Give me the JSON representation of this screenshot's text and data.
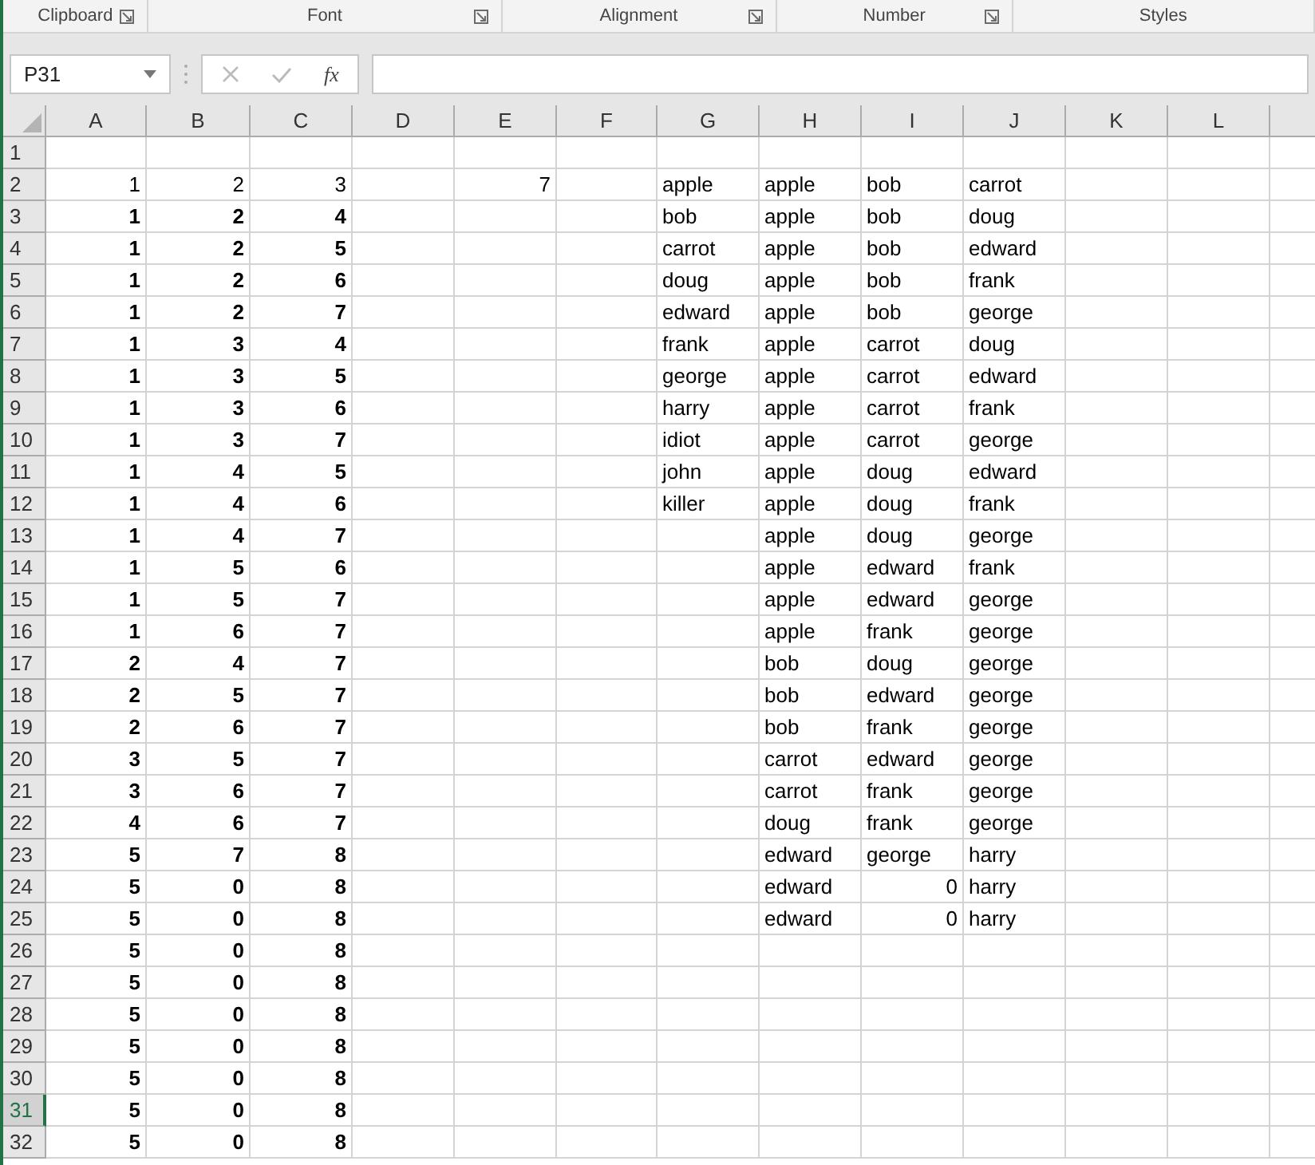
{
  "ribbon_groups": [
    {
      "label": "Clipboard",
      "launcher": true
    },
    {
      "label": "Font",
      "launcher": true
    },
    {
      "label": "Alignment",
      "launcher": true
    },
    {
      "label": "Number",
      "launcher": true
    },
    {
      "label": "Styles",
      "launcher": false
    }
  ],
  "name_box": {
    "value": "P31"
  },
  "formula_bar": {
    "fx": "fx"
  },
  "columns": [
    "A",
    "B",
    "C",
    "D",
    "E",
    "F",
    "G",
    "H",
    "I",
    "J",
    "K",
    "L"
  ],
  "rows": [
    {
      "header": "1",
      "selected": false,
      "cells": []
    },
    {
      "header": "2",
      "selected": false,
      "cells": [
        {
          "text": "1",
          "kind": "number",
          "bold": false
        },
        {
          "text": "2",
          "kind": "number",
          "bold": false
        },
        {
          "text": "3",
          "kind": "number",
          "bold": false
        },
        null,
        {
          "text": "7",
          "kind": "number",
          "bold": false
        },
        null,
        {
          "text": "apple",
          "kind": "text",
          "bold": false
        },
        {
          "text": "apple",
          "kind": "text",
          "bold": false
        },
        {
          "text": "bob",
          "kind": "text",
          "bold": false
        },
        {
          "text": "carrot",
          "kind": "text",
          "bold": false
        }
      ]
    },
    {
      "header": "3",
      "selected": false,
      "cells": [
        {
          "text": "1",
          "kind": "number",
          "bold": true
        },
        {
          "text": "2",
          "kind": "number",
          "bold": true
        },
        {
          "text": "4",
          "kind": "number",
          "bold": true
        },
        null,
        null,
        null,
        {
          "text": "bob",
          "kind": "text",
          "bold": false
        },
        {
          "text": "apple",
          "kind": "text",
          "bold": false
        },
        {
          "text": "bob",
          "kind": "text",
          "bold": false
        },
        {
          "text": "doug",
          "kind": "text",
          "bold": false
        }
      ]
    },
    {
      "header": "4",
      "selected": false,
      "cells": [
        {
          "text": "1",
          "kind": "number",
          "bold": true
        },
        {
          "text": "2",
          "kind": "number",
          "bold": true
        },
        {
          "text": "5",
          "kind": "number",
          "bold": true
        },
        null,
        null,
        null,
        {
          "text": "carrot",
          "kind": "text",
          "bold": false
        },
        {
          "text": "apple",
          "kind": "text",
          "bold": false
        },
        {
          "text": "bob",
          "kind": "text",
          "bold": false
        },
        {
          "text": "edward",
          "kind": "text",
          "bold": false
        }
      ]
    },
    {
      "header": "5",
      "selected": false,
      "cells": [
        {
          "text": "1",
          "kind": "number",
          "bold": true
        },
        {
          "text": "2",
          "kind": "number",
          "bold": true
        },
        {
          "text": "6",
          "kind": "number",
          "bold": true
        },
        null,
        null,
        null,
        {
          "text": "doug",
          "kind": "text",
          "bold": false
        },
        {
          "text": "apple",
          "kind": "text",
          "bold": false
        },
        {
          "text": "bob",
          "kind": "text",
          "bold": false
        },
        {
          "text": "frank",
          "kind": "text",
          "bold": false
        }
      ]
    },
    {
      "header": "6",
      "selected": false,
      "cells": [
        {
          "text": "1",
          "kind": "number",
          "bold": true
        },
        {
          "text": "2",
          "kind": "number",
          "bold": true
        },
        {
          "text": "7",
          "kind": "number",
          "bold": true
        },
        null,
        null,
        null,
        {
          "text": "edward",
          "kind": "text",
          "bold": false
        },
        {
          "text": "apple",
          "kind": "text",
          "bold": false
        },
        {
          "text": "bob",
          "kind": "text",
          "bold": false
        },
        {
          "text": "george",
          "kind": "text",
          "bold": false
        }
      ]
    },
    {
      "header": "7",
      "selected": false,
      "cells": [
        {
          "text": "1",
          "kind": "number",
          "bold": true
        },
        {
          "text": "3",
          "kind": "number",
          "bold": true
        },
        {
          "text": "4",
          "kind": "number",
          "bold": true
        },
        null,
        null,
        null,
        {
          "text": "frank",
          "kind": "text",
          "bold": false
        },
        {
          "text": "apple",
          "kind": "text",
          "bold": false
        },
        {
          "text": "carrot",
          "kind": "text",
          "bold": false
        },
        {
          "text": "doug",
          "kind": "text",
          "bold": false
        }
      ]
    },
    {
      "header": "8",
      "selected": false,
      "cells": [
        {
          "text": "1",
          "kind": "number",
          "bold": true
        },
        {
          "text": "3",
          "kind": "number",
          "bold": true
        },
        {
          "text": "5",
          "kind": "number",
          "bold": true
        },
        null,
        null,
        null,
        {
          "text": "george",
          "kind": "text",
          "bold": false
        },
        {
          "text": "apple",
          "kind": "text",
          "bold": false
        },
        {
          "text": "carrot",
          "kind": "text",
          "bold": false
        },
        {
          "text": "edward",
          "kind": "text",
          "bold": false
        }
      ]
    },
    {
      "header": "9",
      "selected": false,
      "cells": [
        {
          "text": "1",
          "kind": "number",
          "bold": true
        },
        {
          "text": "3",
          "kind": "number",
          "bold": true
        },
        {
          "text": "6",
          "kind": "number",
          "bold": true
        },
        null,
        null,
        null,
        {
          "text": "harry",
          "kind": "text",
          "bold": false
        },
        {
          "text": "apple",
          "kind": "text",
          "bold": false
        },
        {
          "text": "carrot",
          "kind": "text",
          "bold": false
        },
        {
          "text": "frank",
          "kind": "text",
          "bold": false
        }
      ]
    },
    {
      "header": "10",
      "selected": false,
      "cells": [
        {
          "text": "1",
          "kind": "number",
          "bold": true
        },
        {
          "text": "3",
          "kind": "number",
          "bold": true
        },
        {
          "text": "7",
          "kind": "number",
          "bold": true
        },
        null,
        null,
        null,
        {
          "text": "idiot",
          "kind": "text",
          "bold": false
        },
        {
          "text": "apple",
          "kind": "text",
          "bold": false
        },
        {
          "text": "carrot",
          "kind": "text",
          "bold": false
        },
        {
          "text": "george",
          "kind": "text",
          "bold": false
        }
      ]
    },
    {
      "header": "11",
      "selected": false,
      "cells": [
        {
          "text": "1",
          "kind": "number",
          "bold": true
        },
        {
          "text": "4",
          "kind": "number",
          "bold": true
        },
        {
          "text": "5",
          "kind": "number",
          "bold": true
        },
        null,
        null,
        null,
        {
          "text": "john",
          "kind": "text",
          "bold": false
        },
        {
          "text": "apple",
          "kind": "text",
          "bold": false
        },
        {
          "text": "doug",
          "kind": "text",
          "bold": false
        },
        {
          "text": "edward",
          "kind": "text",
          "bold": false
        }
      ]
    },
    {
      "header": "12",
      "selected": false,
      "cells": [
        {
          "text": "1",
          "kind": "number",
          "bold": true
        },
        {
          "text": "4",
          "kind": "number",
          "bold": true
        },
        {
          "text": "6",
          "kind": "number",
          "bold": true
        },
        null,
        null,
        null,
        {
          "text": "killer",
          "kind": "text",
          "bold": false
        },
        {
          "text": "apple",
          "kind": "text",
          "bold": false
        },
        {
          "text": "doug",
          "kind": "text",
          "bold": false
        },
        {
          "text": "frank",
          "kind": "text",
          "bold": false
        }
      ]
    },
    {
      "header": "13",
      "selected": false,
      "cells": [
        {
          "text": "1",
          "kind": "number",
          "bold": true
        },
        {
          "text": "4",
          "kind": "number",
          "bold": true
        },
        {
          "text": "7",
          "kind": "number",
          "bold": true
        },
        null,
        null,
        null,
        null,
        {
          "text": "apple",
          "kind": "text",
          "bold": false
        },
        {
          "text": "doug",
          "kind": "text",
          "bold": false
        },
        {
          "text": "george",
          "kind": "text",
          "bold": false
        }
      ]
    },
    {
      "header": "14",
      "selected": false,
      "cells": [
        {
          "text": "1",
          "kind": "number",
          "bold": true
        },
        {
          "text": "5",
          "kind": "number",
          "bold": true
        },
        {
          "text": "6",
          "kind": "number",
          "bold": true
        },
        null,
        null,
        null,
        null,
        {
          "text": "apple",
          "kind": "text",
          "bold": false
        },
        {
          "text": "edward",
          "kind": "text",
          "bold": false
        },
        {
          "text": "frank",
          "kind": "text",
          "bold": false
        }
      ]
    },
    {
      "header": "15",
      "selected": false,
      "cells": [
        {
          "text": "1",
          "kind": "number",
          "bold": true
        },
        {
          "text": "5",
          "kind": "number",
          "bold": true
        },
        {
          "text": "7",
          "kind": "number",
          "bold": true
        },
        null,
        null,
        null,
        null,
        {
          "text": "apple",
          "kind": "text",
          "bold": false
        },
        {
          "text": "edward",
          "kind": "text",
          "bold": false
        },
        {
          "text": "george",
          "kind": "text",
          "bold": false
        }
      ]
    },
    {
      "header": "16",
      "selected": false,
      "cells": [
        {
          "text": "1",
          "kind": "number",
          "bold": true
        },
        {
          "text": "6",
          "kind": "number",
          "bold": true
        },
        {
          "text": "7",
          "kind": "number",
          "bold": true
        },
        null,
        null,
        null,
        null,
        {
          "text": "apple",
          "kind": "text",
          "bold": false
        },
        {
          "text": "frank",
          "kind": "text",
          "bold": false
        },
        {
          "text": "george",
          "kind": "text",
          "bold": false
        }
      ]
    },
    {
      "header": "17",
      "selected": false,
      "cells": [
        {
          "text": "2",
          "kind": "number",
          "bold": true
        },
        {
          "text": "4",
          "kind": "number",
          "bold": true
        },
        {
          "text": "7",
          "kind": "number",
          "bold": true
        },
        null,
        null,
        null,
        null,
        {
          "text": "bob",
          "kind": "text",
          "bold": false
        },
        {
          "text": "doug",
          "kind": "text",
          "bold": false
        },
        {
          "text": "george",
          "kind": "text",
          "bold": false
        }
      ]
    },
    {
      "header": "18",
      "selected": false,
      "cells": [
        {
          "text": "2",
          "kind": "number",
          "bold": true
        },
        {
          "text": "5",
          "kind": "number",
          "bold": true
        },
        {
          "text": "7",
          "kind": "number",
          "bold": true
        },
        null,
        null,
        null,
        null,
        {
          "text": "bob",
          "kind": "text",
          "bold": false
        },
        {
          "text": "edward",
          "kind": "text",
          "bold": false
        },
        {
          "text": "george",
          "kind": "text",
          "bold": false
        }
      ]
    },
    {
      "header": "19",
      "selected": false,
      "cells": [
        {
          "text": "2",
          "kind": "number",
          "bold": true
        },
        {
          "text": "6",
          "kind": "number",
          "bold": true
        },
        {
          "text": "7",
          "kind": "number",
          "bold": true
        },
        null,
        null,
        null,
        null,
        {
          "text": "bob",
          "kind": "text",
          "bold": false
        },
        {
          "text": "frank",
          "kind": "text",
          "bold": false
        },
        {
          "text": "george",
          "kind": "text",
          "bold": false
        }
      ]
    },
    {
      "header": "20",
      "selected": false,
      "cells": [
        {
          "text": "3",
          "kind": "number",
          "bold": true
        },
        {
          "text": "5",
          "kind": "number",
          "bold": true
        },
        {
          "text": "7",
          "kind": "number",
          "bold": true
        },
        null,
        null,
        null,
        null,
        {
          "text": "carrot",
          "kind": "text",
          "bold": false
        },
        {
          "text": "edward",
          "kind": "text",
          "bold": false
        },
        {
          "text": "george",
          "kind": "text",
          "bold": false
        }
      ]
    },
    {
      "header": "21",
      "selected": false,
      "cells": [
        {
          "text": "3",
          "kind": "number",
          "bold": true
        },
        {
          "text": "6",
          "kind": "number",
          "bold": true
        },
        {
          "text": "7",
          "kind": "number",
          "bold": true
        },
        null,
        null,
        null,
        null,
        {
          "text": "carrot",
          "kind": "text",
          "bold": false
        },
        {
          "text": "frank",
          "kind": "text",
          "bold": false
        },
        {
          "text": "george",
          "kind": "text",
          "bold": false
        }
      ]
    },
    {
      "header": "22",
      "selected": false,
      "cells": [
        {
          "text": "4",
          "kind": "number",
          "bold": true
        },
        {
          "text": "6",
          "kind": "number",
          "bold": true
        },
        {
          "text": "7",
          "kind": "number",
          "bold": true
        },
        null,
        null,
        null,
        null,
        {
          "text": "doug",
          "kind": "text",
          "bold": false
        },
        {
          "text": "frank",
          "kind": "text",
          "bold": false
        },
        {
          "text": "george",
          "kind": "text",
          "bold": false
        }
      ]
    },
    {
      "header": "23",
      "selected": false,
      "cells": [
        {
          "text": "5",
          "kind": "number",
          "bold": true
        },
        {
          "text": "7",
          "kind": "number",
          "bold": true
        },
        {
          "text": "8",
          "kind": "number",
          "bold": true
        },
        null,
        null,
        null,
        null,
        {
          "text": "edward",
          "kind": "text",
          "bold": false
        },
        {
          "text": "george",
          "kind": "text",
          "bold": false
        },
        {
          "text": "harry",
          "kind": "text",
          "bold": false
        }
      ]
    },
    {
      "header": "24",
      "selected": false,
      "cells": [
        {
          "text": "5",
          "kind": "number",
          "bold": true
        },
        {
          "text": "0",
          "kind": "number",
          "bold": true
        },
        {
          "text": "8",
          "kind": "number",
          "bold": true
        },
        null,
        null,
        null,
        null,
        {
          "text": "edward",
          "kind": "text",
          "bold": false
        },
        {
          "text": "0",
          "kind": "number",
          "bold": false
        },
        {
          "text": "harry",
          "kind": "text",
          "bold": false
        }
      ]
    },
    {
      "header": "25",
      "selected": false,
      "cells": [
        {
          "text": "5",
          "kind": "number",
          "bold": true
        },
        {
          "text": "0",
          "kind": "number",
          "bold": true
        },
        {
          "text": "8",
          "kind": "number",
          "bold": true
        },
        null,
        null,
        null,
        null,
        {
          "text": "edward",
          "kind": "text",
          "bold": false
        },
        {
          "text": "0",
          "kind": "number",
          "bold": false
        },
        {
          "text": "harry",
          "kind": "text",
          "bold": false
        }
      ]
    },
    {
      "header": "26",
      "selected": false,
      "cells": [
        {
          "text": "5",
          "kind": "number",
          "bold": true
        },
        {
          "text": "0",
          "kind": "number",
          "bold": true
        },
        {
          "text": "8",
          "kind": "number",
          "bold": true
        }
      ]
    },
    {
      "header": "27",
      "selected": false,
      "cells": [
        {
          "text": "5",
          "kind": "number",
          "bold": true
        },
        {
          "text": "0",
          "kind": "number",
          "bold": true
        },
        {
          "text": "8",
          "kind": "number",
          "bold": true
        }
      ]
    },
    {
      "header": "28",
      "selected": false,
      "cells": [
        {
          "text": "5",
          "kind": "number",
          "bold": true
        },
        {
          "text": "0",
          "kind": "number",
          "bold": true
        },
        {
          "text": "8",
          "kind": "number",
          "bold": true
        }
      ]
    },
    {
      "header": "29",
      "selected": false,
      "cells": [
        {
          "text": "5",
          "kind": "number",
          "bold": true
        },
        {
          "text": "0",
          "kind": "number",
          "bold": true
        },
        {
          "text": "8",
          "kind": "number",
          "bold": true
        }
      ]
    },
    {
      "header": "30",
      "selected": false,
      "cells": [
        {
          "text": "5",
          "kind": "number",
          "bold": true
        },
        {
          "text": "0",
          "kind": "number",
          "bold": true
        },
        {
          "text": "8",
          "kind": "number",
          "bold": true
        }
      ]
    },
    {
      "header": "31",
      "selected": true,
      "cells": [
        {
          "text": "5",
          "kind": "number",
          "bold": true
        },
        {
          "text": "0",
          "kind": "number",
          "bold": true
        },
        {
          "text": "8",
          "kind": "number",
          "bold": true
        }
      ]
    },
    {
      "header": "32",
      "selected": false,
      "cells": [
        {
          "text": "5",
          "kind": "number",
          "bold": true
        },
        {
          "text": "0",
          "kind": "number",
          "bold": true
        },
        {
          "text": "8",
          "kind": "number",
          "bold": true
        }
      ]
    }
  ]
}
